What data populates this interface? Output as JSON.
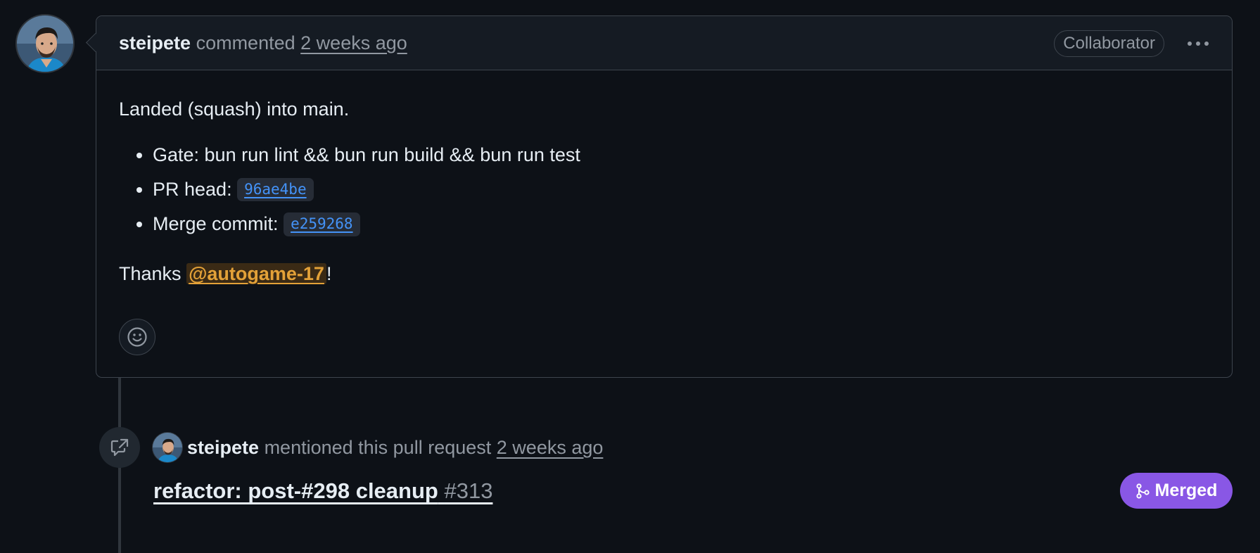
{
  "comment": {
    "author": "steipete",
    "action": "commented",
    "time": "2 weeks ago",
    "badge": "Collaborator",
    "intro": "Landed (squash) into main.",
    "items": [
      {
        "label": "Gate: bun run lint && bun run build && bun run test"
      },
      {
        "label": "PR head:",
        "code": "96ae4be"
      },
      {
        "label": "Merge commit:",
        "code": "e259268"
      }
    ],
    "thanks_prefix": "Thanks",
    "mention": "@autogame-17",
    "thanks_suffix": "!"
  },
  "event": {
    "author": "steipete",
    "action": "mentioned this pull request",
    "time": "2 weeks ago",
    "pr_title": "refactor: post-#298 cleanup",
    "pr_number": "#313",
    "status": "Merged"
  },
  "icons": {
    "kebab": "kebab-horizontal-icon",
    "emoji": "smiley-icon",
    "cross_reference": "cross-reference-icon",
    "merge": "git-merge-icon"
  },
  "colors": {
    "background": "#0d1117",
    "header_bg": "#151b23",
    "border": "#3d444d",
    "link_blue": "#4493f8",
    "mention": "#e3a138",
    "merged_purple": "#8957e5",
    "muted": "#9198a1"
  }
}
